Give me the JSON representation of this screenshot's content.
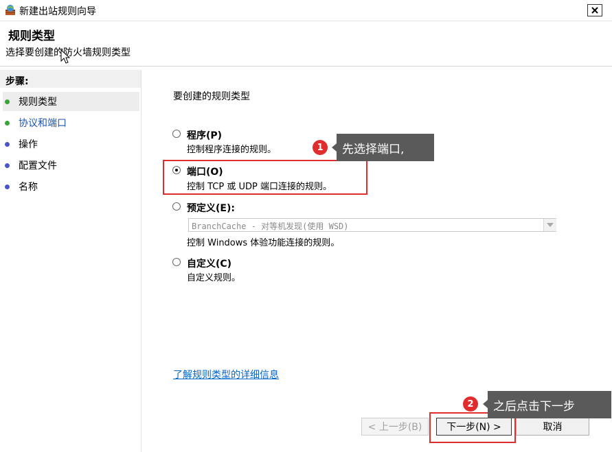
{
  "window": {
    "title": "新建出站规则向导",
    "close_glyph": "✕",
    "app_icon": "firewall-wizard-icon"
  },
  "header": {
    "title": "规则类型",
    "subtitle": "选择要创建的防火墙规则类型"
  },
  "steps": {
    "heading": "步骤:",
    "items": [
      {
        "label": "规则类型",
        "state": "current",
        "dot_color": "#3aa53a"
      },
      {
        "label": "协议和端口",
        "state": "next",
        "dot_color": "#3aa53a"
      },
      {
        "label": "操作",
        "state": "pending",
        "dot_color": "#4a55c8"
      },
      {
        "label": "配置文件",
        "state": "pending",
        "dot_color": "#4a55c8"
      },
      {
        "label": "名称",
        "state": "pending",
        "dot_color": "#4a55c8"
      }
    ]
  },
  "main": {
    "heading": "要创建的规则类型",
    "options": [
      {
        "label": "程序(P)",
        "description": "控制程序连接的规则。",
        "checked": false
      },
      {
        "label": "端口(O)",
        "description": "控制 TCP 或 UDP 端口连接的规则。",
        "checked": true
      },
      {
        "label": "预定义(E):",
        "description": "控制 Windows 体验功能连接的规则。",
        "checked": false
      },
      {
        "label": "自定义(C)",
        "description": "自定义规则。",
        "checked": false
      }
    ],
    "predefined_select_value": "BranchCache - 对等机发现(使用 WSD)",
    "learn_more_link": "了解规则类型的详细信息"
  },
  "buttons": {
    "back": "< 上一步(B)",
    "next": "下一步(N) >",
    "cancel": "取消"
  },
  "annotations": {
    "callout1": {
      "number": "1",
      "text": "先选择端口,"
    },
    "callout2": {
      "number": "2",
      "text": "之后点击下一步"
    }
  },
  "colors": {
    "highlight": "#e02c2c",
    "link": "#0066cc",
    "callout_bg": "#5a5a5a"
  }
}
